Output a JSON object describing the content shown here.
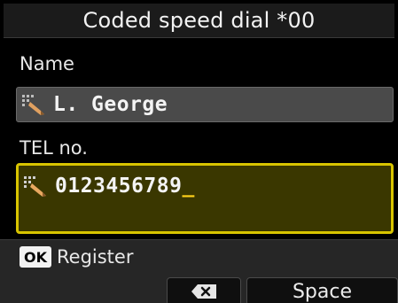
{
  "title": "Coded speed dial *00",
  "name_field": {
    "label": "Name",
    "value": "L. George",
    "icon": "pen-edit-icon"
  },
  "tel_field": {
    "label": "TEL no.",
    "value": "0123456789",
    "cursor": "_",
    "icon": "pen-edit-icon",
    "highlight_color": "#d8c400"
  },
  "footer": {
    "ok_badge": "OK",
    "ok_label": "Register",
    "backspace_icon": "backspace-icon",
    "space_label": "Space"
  }
}
